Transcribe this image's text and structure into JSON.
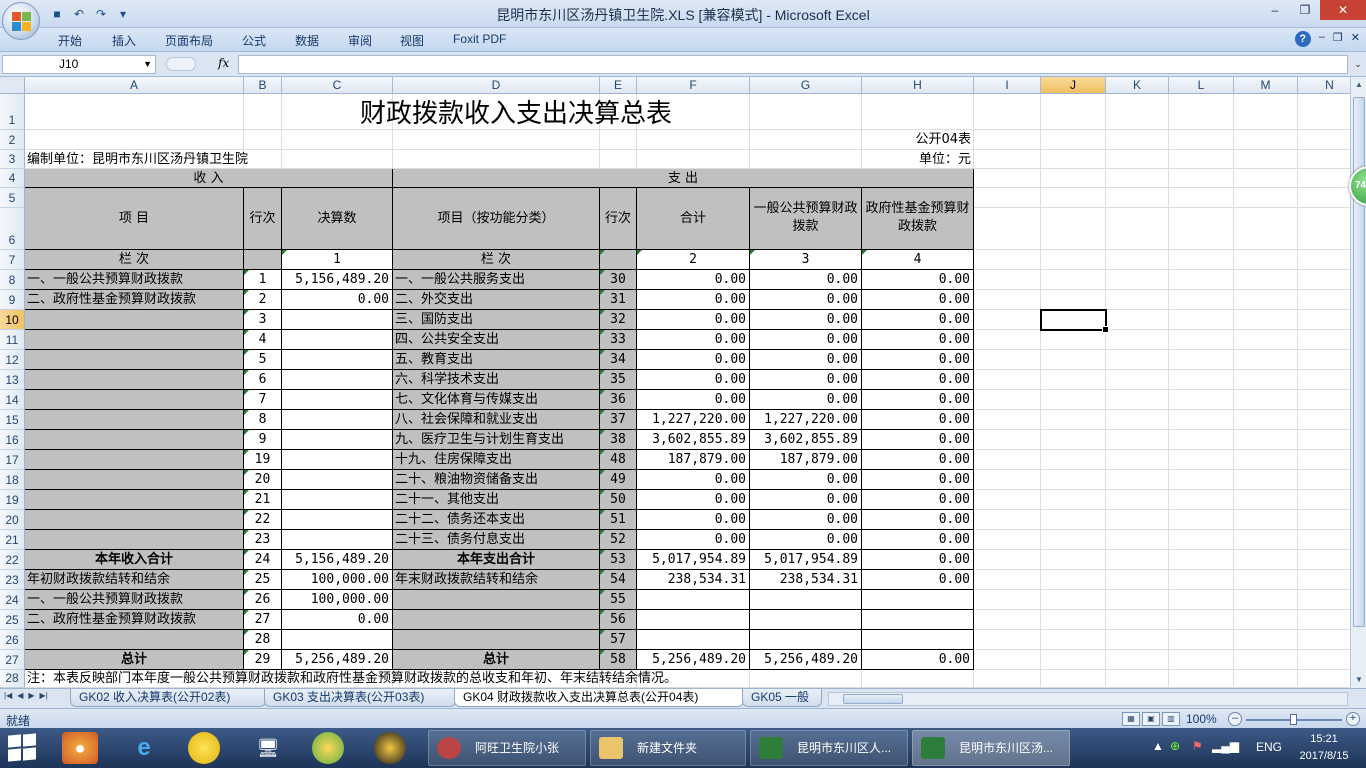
{
  "app": {
    "window_title": "昆明市东川区汤丹镇卫生院.XLS  [兼容模式] - Microsoft Excel",
    "ribbon_tabs": [
      "开始",
      "插入",
      "页面布局",
      "公式",
      "数据",
      "审阅",
      "视图",
      "Foxit PDF"
    ],
    "name_box": "J10",
    "formula_value": "",
    "fx_label": "fx"
  },
  "sheet": {
    "columns": [
      "A",
      "B",
      "C",
      "D",
      "E",
      "F",
      "G",
      "H",
      "I",
      "J",
      "K",
      "L",
      "M",
      "N"
    ],
    "rows": [
      "1",
      "2",
      "3",
      "4",
      "5",
      "6",
      "7",
      "8",
      "9",
      "10",
      "11",
      "12",
      "13",
      "14",
      "15",
      "16",
      "17",
      "18",
      "19",
      "20",
      "21",
      "22",
      "23",
      "24",
      "25",
      "26",
      "27",
      "28"
    ],
    "title": "财政拨款收入支出决算总表",
    "form_no": "公开04表",
    "unit_label": "编制单位：昆明市东川区汤丹镇卫生院",
    "currency": "单位：元",
    "header_income": "收        入",
    "header_expense": "支        出",
    "h_item": "项        目",
    "h_lineno": "行次",
    "h_amount": "决算数",
    "h_item_func": "项目（按功能分类）",
    "h_lineno2": "行次",
    "h_total": "合计",
    "h_general": "一般公共预算财政拨款",
    "h_fund": "政府性基金预算财政拨款",
    "col_label": "栏        次",
    "col_label2": "栏        次",
    "col_nums": [
      "1",
      "2",
      "3",
      "4"
    ],
    "income_rows": [
      {
        "item": "一、一般公共预算财政拨款",
        "line": "1",
        "amount": "5,156,489.20"
      },
      {
        "item": "二、政府性基金预算财政拨款",
        "line": "2",
        "amount": "0.00"
      },
      {
        "item": "",
        "line": "3",
        "amount": ""
      },
      {
        "item": "",
        "line": "4",
        "amount": ""
      },
      {
        "item": "",
        "line": "5",
        "amount": ""
      },
      {
        "item": "",
        "line": "6",
        "amount": ""
      },
      {
        "item": "",
        "line": "7",
        "amount": ""
      },
      {
        "item": "",
        "line": "8",
        "amount": ""
      },
      {
        "item": "",
        "line": "9",
        "amount": ""
      },
      {
        "item": "",
        "line": "19",
        "amount": ""
      },
      {
        "item": "",
        "line": "20",
        "amount": ""
      },
      {
        "item": "",
        "line": "21",
        "amount": ""
      },
      {
        "item": "",
        "line": "22",
        "amount": ""
      },
      {
        "item": "",
        "line": "23",
        "amount": ""
      },
      {
        "item": "本年收入合计",
        "line": "24",
        "amount": "5,156,489.20"
      },
      {
        "item": "年初财政拨款结转和结余",
        "line": "25",
        "amount": "100,000.00"
      },
      {
        "item": "一、一般公共预算财政拨款",
        "line": "26",
        "amount": "100,000.00"
      },
      {
        "item": "二、政府性基金预算财政拨款",
        "line": "27",
        "amount": "0.00"
      },
      {
        "item": "",
        "line": "28",
        "amount": ""
      },
      {
        "item": "总计",
        "line": "29",
        "amount": "5,256,489.20"
      }
    ],
    "expense_rows": [
      {
        "item": "一、一般公共服务支出",
        "line": "30",
        "total": "0.00",
        "general": "0.00",
        "fund": "0.00"
      },
      {
        "item": "二、外交支出",
        "line": "31",
        "total": "0.00",
        "general": "0.00",
        "fund": "0.00"
      },
      {
        "item": "三、国防支出",
        "line": "32",
        "total": "0.00",
        "general": "0.00",
        "fund": "0.00"
      },
      {
        "item": "四、公共安全支出",
        "line": "33",
        "total": "0.00",
        "general": "0.00",
        "fund": "0.00"
      },
      {
        "item": "五、教育支出",
        "line": "34",
        "total": "0.00",
        "general": "0.00",
        "fund": "0.00"
      },
      {
        "item": "六、科学技术支出",
        "line": "35",
        "total": "0.00",
        "general": "0.00",
        "fund": "0.00"
      },
      {
        "item": "七、文化体育与传媒支出",
        "line": "36",
        "total": "0.00",
        "general": "0.00",
        "fund": "0.00"
      },
      {
        "item": "八、社会保障和就业支出",
        "line": "37",
        "total": "1,227,220.00",
        "general": "1,227,220.00",
        "fund": "0.00"
      },
      {
        "item": "九、医疗卫生与计划生育支出",
        "line": "38",
        "total": "3,602,855.89",
        "general": "3,602,855.89",
        "fund": "0.00"
      },
      {
        "item": "十九、住房保障支出",
        "line": "48",
        "total": "187,879.00",
        "general": "187,879.00",
        "fund": "0.00"
      },
      {
        "item": "二十、粮油物资储备支出",
        "line": "49",
        "total": "0.00",
        "general": "0.00",
        "fund": "0.00"
      },
      {
        "item": "二十一、其他支出",
        "line": "50",
        "total": "0.00",
        "general": "0.00",
        "fund": "0.00"
      },
      {
        "item": "二十二、债务还本支出",
        "line": "51",
        "total": "0.00",
        "general": "0.00",
        "fund": "0.00"
      },
      {
        "item": "二十三、债务付息支出",
        "line": "52",
        "total": "0.00",
        "general": "0.00",
        "fund": "0.00"
      },
      {
        "item": "本年支出合计",
        "line": "53",
        "total": "5,017,954.89",
        "general": "5,017,954.89",
        "fund": "0.00"
      },
      {
        "item": "年末财政拨款结转和结余",
        "line": "54",
        "total": "238,534.31",
        "general": "238,534.31",
        "fund": "0.00"
      },
      {
        "item": "",
        "line": "55",
        "total": "",
        "general": "",
        "fund": ""
      },
      {
        "item": "",
        "line": "56",
        "total": "",
        "general": "",
        "fund": ""
      },
      {
        "item": "",
        "line": "57",
        "total": "",
        "general": "",
        "fund": ""
      },
      {
        "item": "总计",
        "line": "58",
        "total": "5,256,489.20",
        "general": "5,256,489.20",
        "fund": "0.00"
      }
    ],
    "note": "注：本表反映部门本年度一般公共预算财政拨款和政府性基金预算财政拨款的总收支和年初、年末结转结余情况。"
  },
  "sheet_tabs": [
    {
      "label": "GK02 收入决算表(公开02表)",
      "active": false
    },
    {
      "label": "GK03 支出决算表(公开03表)",
      "active": false
    },
    {
      "label": "GK04 财政拨款收入支出决算总表(公开04表)",
      "active": true
    },
    {
      "label": "GK05 一般",
      "active": false
    }
  ],
  "status": {
    "text": "就绪",
    "zoom": "100%"
  },
  "taskbar": {
    "apps": [
      {
        "label": "阿旺卫生院小张"
      },
      {
        "label": "新建文件夹"
      },
      {
        "label": "昆明市东川区人..."
      },
      {
        "label": "昆明市东川区汤..."
      }
    ],
    "lang": "ENG",
    "time": "15:21",
    "date": "2017/8/15"
  },
  "badge": "74",
  "colors": {
    "table_gray": "#c0c0c0",
    "active_header": "#f1c15f",
    "taskbar": "#2a4670"
  }
}
